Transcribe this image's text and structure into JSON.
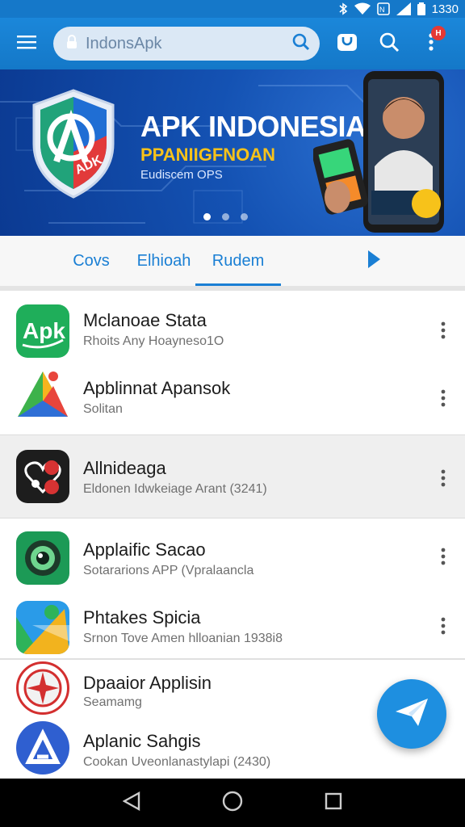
{
  "status_bar": {
    "time": "1330",
    "icons": [
      "bluetooth-icon",
      "wifi-icon",
      "nfc-icon",
      "signal-icon",
      "battery-icon"
    ]
  },
  "app_bar": {
    "search_text": "IndonsApk",
    "notification_badge": "H",
    "icons": [
      "menu-icon",
      "lock-icon",
      "search-icon",
      "bag-icon",
      "search-icon",
      "overflow-icon"
    ]
  },
  "banner": {
    "title": "APK INDONESIA",
    "subtitle": "PPANIIGFNOAN",
    "tagline": "Eudiscem OPS",
    "badge_text": "ADK",
    "carousel_pages": 3,
    "carousel_active": 0
  },
  "tabs": [
    {
      "label": "Covs",
      "active": false
    },
    {
      "label": "Elhioah",
      "active": false
    },
    {
      "label": "Rudem",
      "active": true
    }
  ],
  "apps": [
    {
      "title": "Mclanoae Stata",
      "subtitle": "Rhoits Any Hoayneso1O",
      "icon": "apk-logo-icon",
      "selected": false
    },
    {
      "title": "Apblinnat Apansok",
      "subtitle": "Solitan",
      "icon": "play-triangle-icon",
      "selected": false
    },
    {
      "title": "Allnideaga",
      "subtitle": "Eldonen Idwkeiage Arant (3241)",
      "icon": "heart-plugs-icon",
      "selected": true
    },
    {
      "title": "Applaific Sacao",
      "subtitle": "Sotararions APP (Vpralaancla",
      "icon": "camera-lens-icon",
      "selected": false
    },
    {
      "title": "Phtakes Spicia",
      "subtitle": "Srnon Tove Amen hlloanian 1938i8",
      "icon": "maps-icon",
      "selected": false
    },
    {
      "title": "Dpaaior Applisin",
      "subtitle": "Seamamg",
      "icon": "star-emblem-icon",
      "selected": false
    },
    {
      "title": "Aplanic Sahgis",
      "subtitle": "Cookan Uveonlanastylapi (2430)",
      "icon": "a-logo-icon",
      "selected": false
    }
  ],
  "fab": {
    "icon": "send-plane-icon"
  },
  "nav_bar": {
    "icons": [
      "back-icon",
      "home-icon",
      "recents-icon"
    ]
  },
  "colors": {
    "primary": "#1b87da",
    "banner": "#1452b3",
    "accent_yellow": "#f7c21a",
    "fab": "#1e8fe0"
  }
}
